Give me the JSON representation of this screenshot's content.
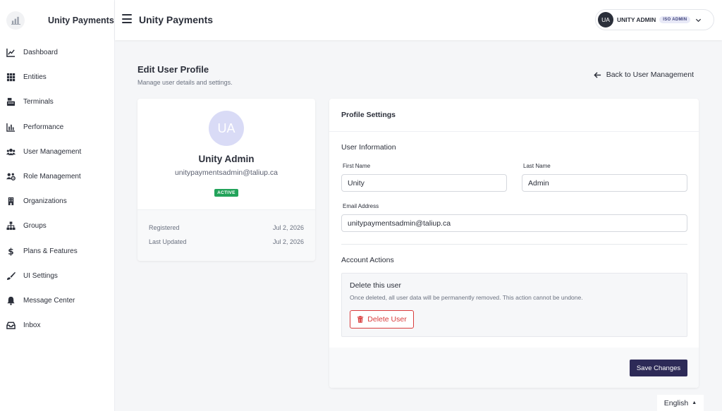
{
  "brand": {
    "name": "Unity Payments"
  },
  "sidebar": {
    "items": [
      {
        "label": "Dashboard",
        "icon": "chart-line-icon"
      },
      {
        "label": "Entities",
        "icon": "grid-icon"
      },
      {
        "label": "Terminals",
        "icon": "cash-register-icon"
      },
      {
        "label": "Performance",
        "icon": "bar-chart-icon"
      },
      {
        "label": "User Management",
        "icon": "users-icon"
      },
      {
        "label": "Role Management",
        "icon": "users-cog-icon"
      },
      {
        "label": "Organizations",
        "icon": "building-icon"
      },
      {
        "label": "Groups",
        "icon": "sitemap-icon"
      },
      {
        "label": "Plans & Features",
        "icon": "dollar-icon"
      },
      {
        "label": "UI Settings",
        "icon": "brush-icon"
      },
      {
        "label": "Message Center",
        "icon": "bell-icon"
      },
      {
        "label": "Inbox",
        "icon": "inbox-icon"
      }
    ]
  },
  "header": {
    "title": "Unity Payments",
    "user": {
      "initials": "UA",
      "name": "UNITY ADMIN",
      "role": "ISO ADMIN"
    }
  },
  "page": {
    "title": "Edit User Profile",
    "subtitle": "Manage user details and settings.",
    "back_label": "Back to User Management"
  },
  "profile": {
    "initials": "UA",
    "name": "Unity Admin",
    "email": "unitypaymentsadmin@taliup.ca",
    "status": "ACTIVE",
    "registered_label": "Registered",
    "registered_value": "Jul 2, 2026",
    "updated_label": "Last Updated",
    "updated_value": "Jul 2, 2026"
  },
  "settings": {
    "title": "Profile Settings",
    "user_info_title": "User Information",
    "first_name_label": "First Name",
    "first_name_value": "Unity",
    "last_name_label": "Last Name",
    "last_name_value": "Admin",
    "email_label": "Email Address",
    "email_value": "unitypaymentsadmin@taliup.ca",
    "account_actions_title": "Account Actions",
    "delete_title": "Delete this user",
    "delete_desc": "Once deleted, all user data will be permanently removed. This action cannot be undone.",
    "delete_button": "Delete User",
    "save_button": "Save Changes"
  },
  "language": {
    "selected": "English"
  },
  "colors": {
    "primary": "#2d2a57",
    "danger": "#d93b3b",
    "success": "#22a35a",
    "avatar_bg": "#d9dbf6"
  }
}
